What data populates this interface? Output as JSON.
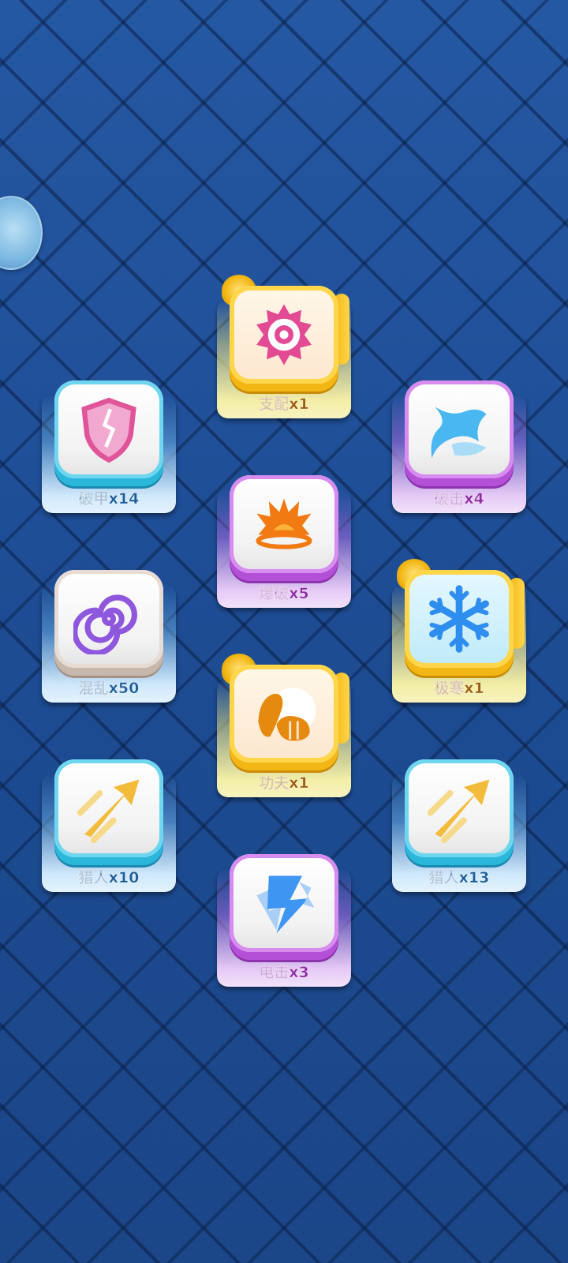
{
  "avatar": {
    "icon": "monster-avatar-icon"
  },
  "skills": [
    {
      "label": "支配x1",
      "rarity": "gold",
      "icon": "eye-creature-icon",
      "accent": "#e24a93"
    },
    {
      "label": "破甲x14",
      "rarity": "blue",
      "icon": "broken-shield-icon",
      "accent": "#e0559a"
    },
    {
      "label": "破击x4",
      "rarity": "purple",
      "icon": "water-splash-icon",
      "accent": "#4ab8f0"
    },
    {
      "label": "爆破x5",
      "rarity": "purple",
      "icon": "explosion-icon",
      "accent": "#f27a12"
    },
    {
      "label": "混乱x50",
      "rarity": "grey",
      "icon": "spiral-icon",
      "accent": "#8f57dd"
    },
    {
      "label": "极寒x1",
      "rarity": "gold",
      "icon": "snowflake-icon",
      "accent": "#2e8ef0"
    },
    {
      "label": "功夫x1",
      "rarity": "gold",
      "icon": "fist-icon",
      "accent": "#e6890f"
    },
    {
      "label": "猎人x10",
      "rarity": "blue",
      "icon": "arrow-icon",
      "accent": "#f2bc3a"
    },
    {
      "label": "猎人x13",
      "rarity": "blue",
      "icon": "arrow-icon",
      "accent": "#f2bc3a"
    },
    {
      "label": "电击x3",
      "rarity": "purple",
      "icon": "lightning-icon",
      "accent": "#3f95f2"
    }
  ]
}
